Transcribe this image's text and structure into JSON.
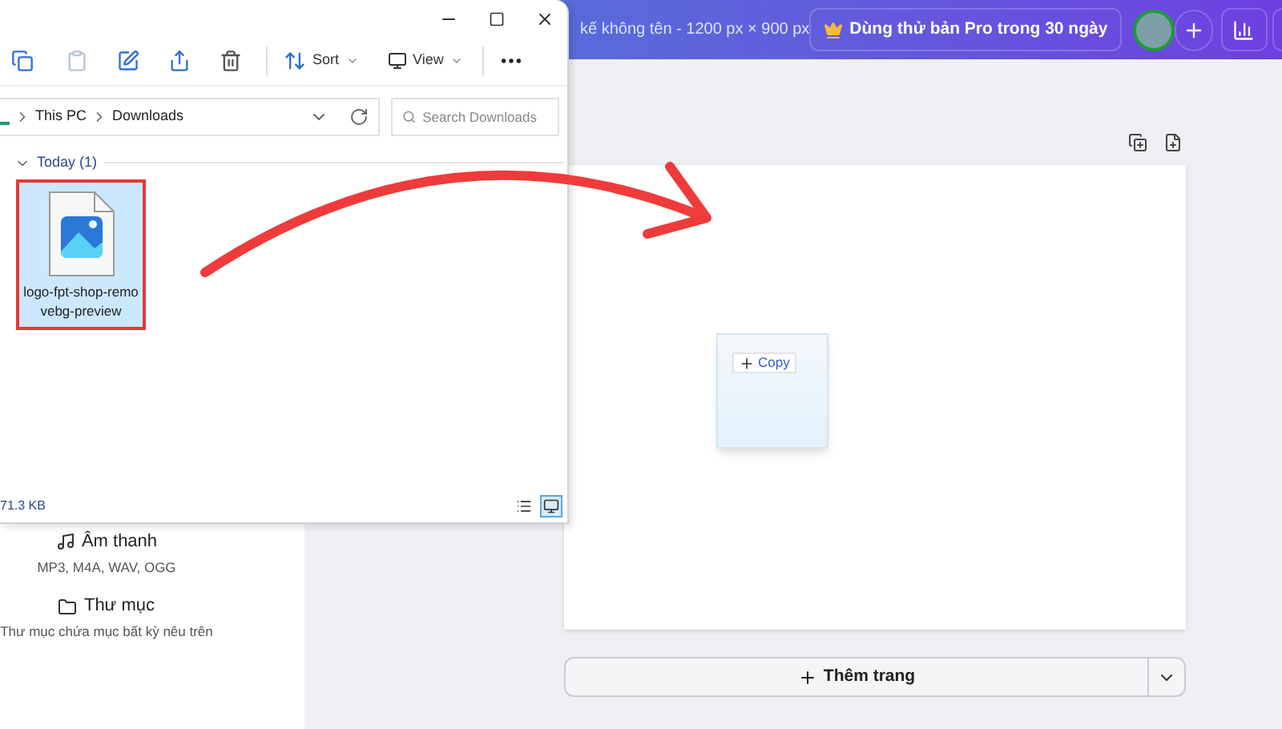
{
  "canva": {
    "title": "kế không tên - 1200 px × 900 px",
    "pro_button": "Dùng thử bản Pro trong 30 ngày",
    "side_panel": [
      {
        "kind": "audio",
        "title": "Âm thanh",
        "desc": "MP3, M4A, WAV, OGG"
      },
      {
        "kind": "folder",
        "title": "Thư mục",
        "desc": "Thư mục chứa mục bất kỳ nêu trên"
      }
    ],
    "drag_label": "Copy",
    "add_page_button": "Thêm trang"
  },
  "explorer": {
    "toolbar": {
      "sort": "Sort",
      "view": "View"
    },
    "path": [
      "This PC",
      "Downloads"
    ],
    "search": {
      "placeholder": "Search Downloads"
    },
    "group": "Today (1)",
    "files": [
      {
        "name": "logo-fpt-shop-removebg-preview",
        "selected": true
      }
    ],
    "status": "71.3 KB",
    "views": [
      {
        "kind": "details",
        "selected": false
      },
      {
        "kind": "tiles",
        "selected": true
      }
    ]
  }
}
